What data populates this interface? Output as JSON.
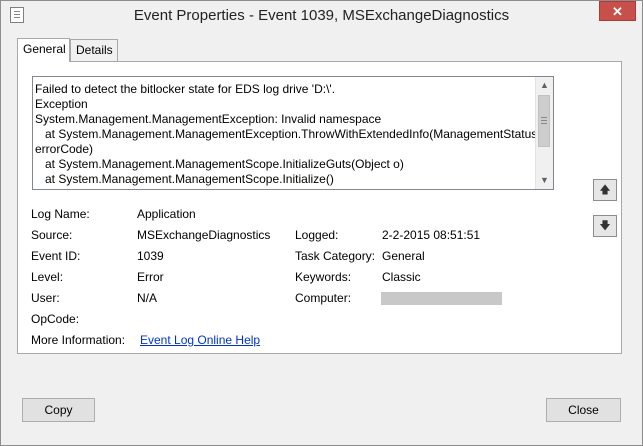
{
  "window": {
    "title": "Event Properties - Event 1039, MSExchangeDiagnostics",
    "close_glyph": "✕"
  },
  "tabs": [
    {
      "label": "General",
      "active": true
    },
    {
      "label": "Details",
      "active": false
    }
  ],
  "description": {
    "lines": [
      "Failed to detect the bitlocker state for EDS log drive 'D:\\'.",
      "Exception",
      "System.Management.ManagementException: Invalid namespace",
      "   at System.Management.ManagementException.ThrowWithExtendedInfo(ManagementStatus",
      "errorCode)",
      "   at System.Management.ManagementScope.InitializeGuts(Object o)",
      "   at System.Management.ManagementScope.Initialize()"
    ]
  },
  "fields": {
    "log_name": {
      "label": "Log Name:",
      "value": "Application"
    },
    "source": {
      "label": "Source:",
      "value": "MSExchangeDiagnostics"
    },
    "logged": {
      "label": "Logged:",
      "value": "2-2-2015 08:51:51"
    },
    "event_id": {
      "label": "Event ID:",
      "value": "1039"
    },
    "task_category": {
      "label": "Task Category:",
      "value": "General"
    },
    "level": {
      "label": "Level:",
      "value": "Error"
    },
    "keywords": {
      "label": "Keywords:",
      "value": "Classic"
    },
    "user": {
      "label": "User:",
      "value": "N/A"
    },
    "computer": {
      "label": "Computer:",
      "value": ""
    },
    "opcode": {
      "label": "OpCode:",
      "value": ""
    },
    "more_info": {
      "label": "More Information:",
      "link": "Event Log Online Help"
    }
  },
  "buttons": {
    "copy": "Copy",
    "close": "Close"
  },
  "icons": {
    "up": "arrow-up-icon",
    "down": "arrow-down-icon"
  }
}
